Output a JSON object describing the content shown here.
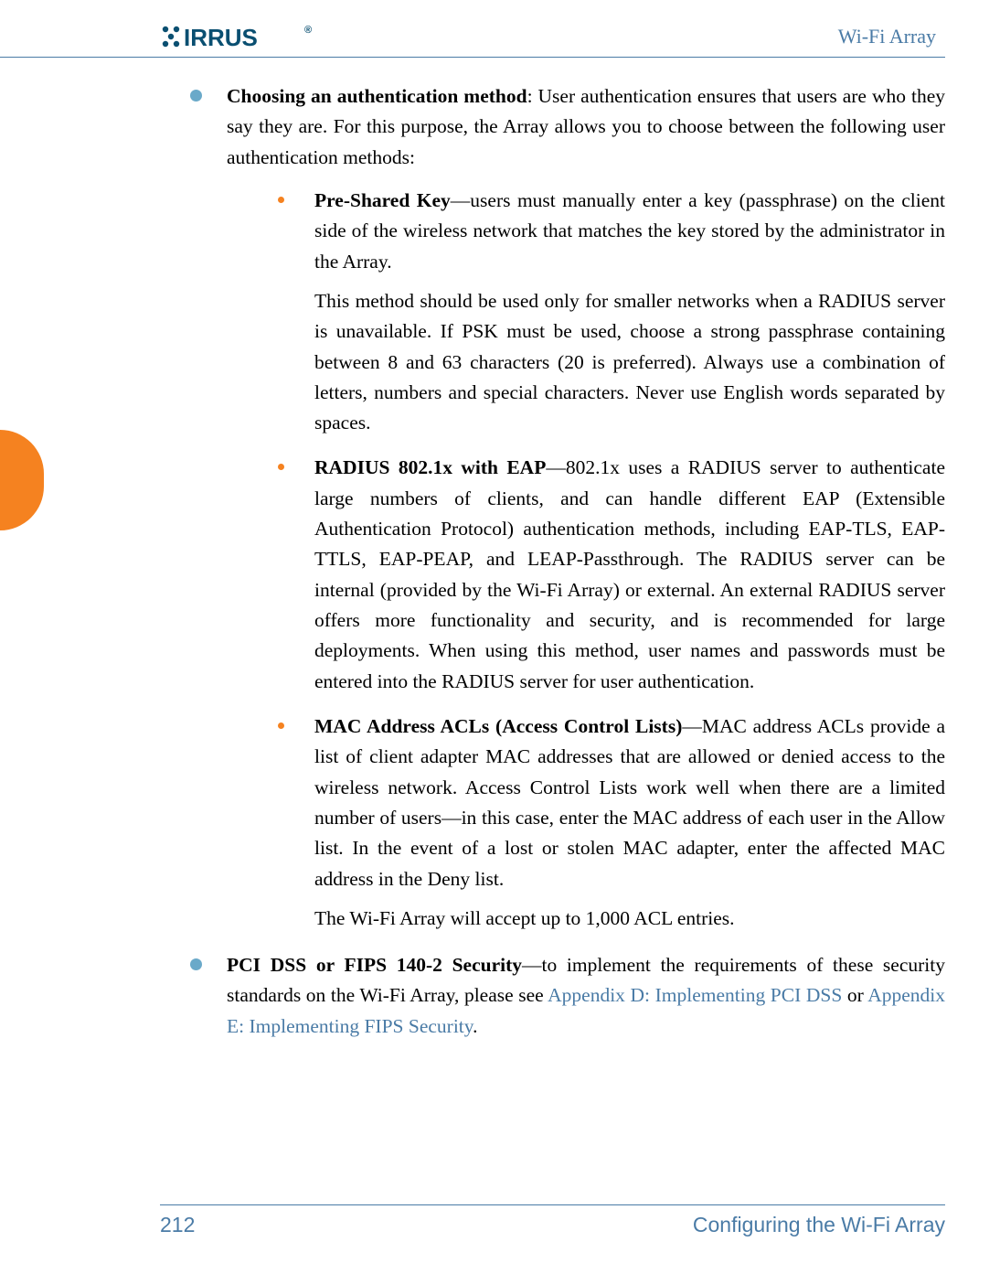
{
  "header": {
    "logo_text": "XIRRUS",
    "product": "Wi-Fi Array"
  },
  "body": {
    "item1": {
      "lead": "Choosing an authentication method",
      "intro": ": User authentication ensures that users are who they say they are. For this purpose, the Array allows you to choose between the following user authentication methods:",
      "sub1": {
        "title": "Pre-Shared Key",
        "text1": "—users must manually enter a key (passphrase) on the client side of the wireless network that matches the key stored by the administrator in the Array.",
        "text2": "This method should be used only for smaller networks when a RADIUS server is unavailable. If PSK must be used, choose a strong passphrase containing between 8 and 63 characters (20 is preferred). Always use a combination of letters, numbers and special characters. Never use English words separated by spaces."
      },
      "sub2": {
        "title": "RADIUS 802.1x with EAP",
        "text": "—802.1x uses a RADIUS server to authenticate large numbers of clients, and can handle different EAP (Extensible Authentication Protocol) authentication methods, including EAP-TLS, EAP-TTLS, EAP-PEAP, and LEAP-Passthrough. The RADIUS server can be internal (provided by the Wi-Fi Array) or external. An external RADIUS server offers more functionality and security, and is recommended for large deployments. When using this method, user names and passwords must be entered into the RADIUS server for user authentication."
      },
      "sub3": {
        "title": "MAC Address ACLs (Access Control Lists)",
        "text1": "—MAC address ACLs provide a list of client adapter MAC addresses that are allowed or denied access to the wireless network. Access Control Lists work well when there are a limited number of users—in this case, enter the MAC address of each user in the Allow list. In the event of a lost or stolen MAC adapter, enter the affected MAC address in the Deny list.",
        "text2": "The Wi-Fi Array will accept up to 1,000 ACL entries."
      }
    },
    "item2": {
      "lead": "PCI DSS or FIPS 140-2 Security",
      "text_before": "—to implement the requirements of these security standards on the Wi-Fi Array, please see ",
      "link1": "Appendix D: Implementing PCI DSS",
      "mid": " or ",
      "link2": "Appendix E: Implementing FIPS Security",
      "after": "."
    }
  },
  "footer": {
    "page": "212",
    "section": "Configuring the Wi-Fi Array"
  }
}
